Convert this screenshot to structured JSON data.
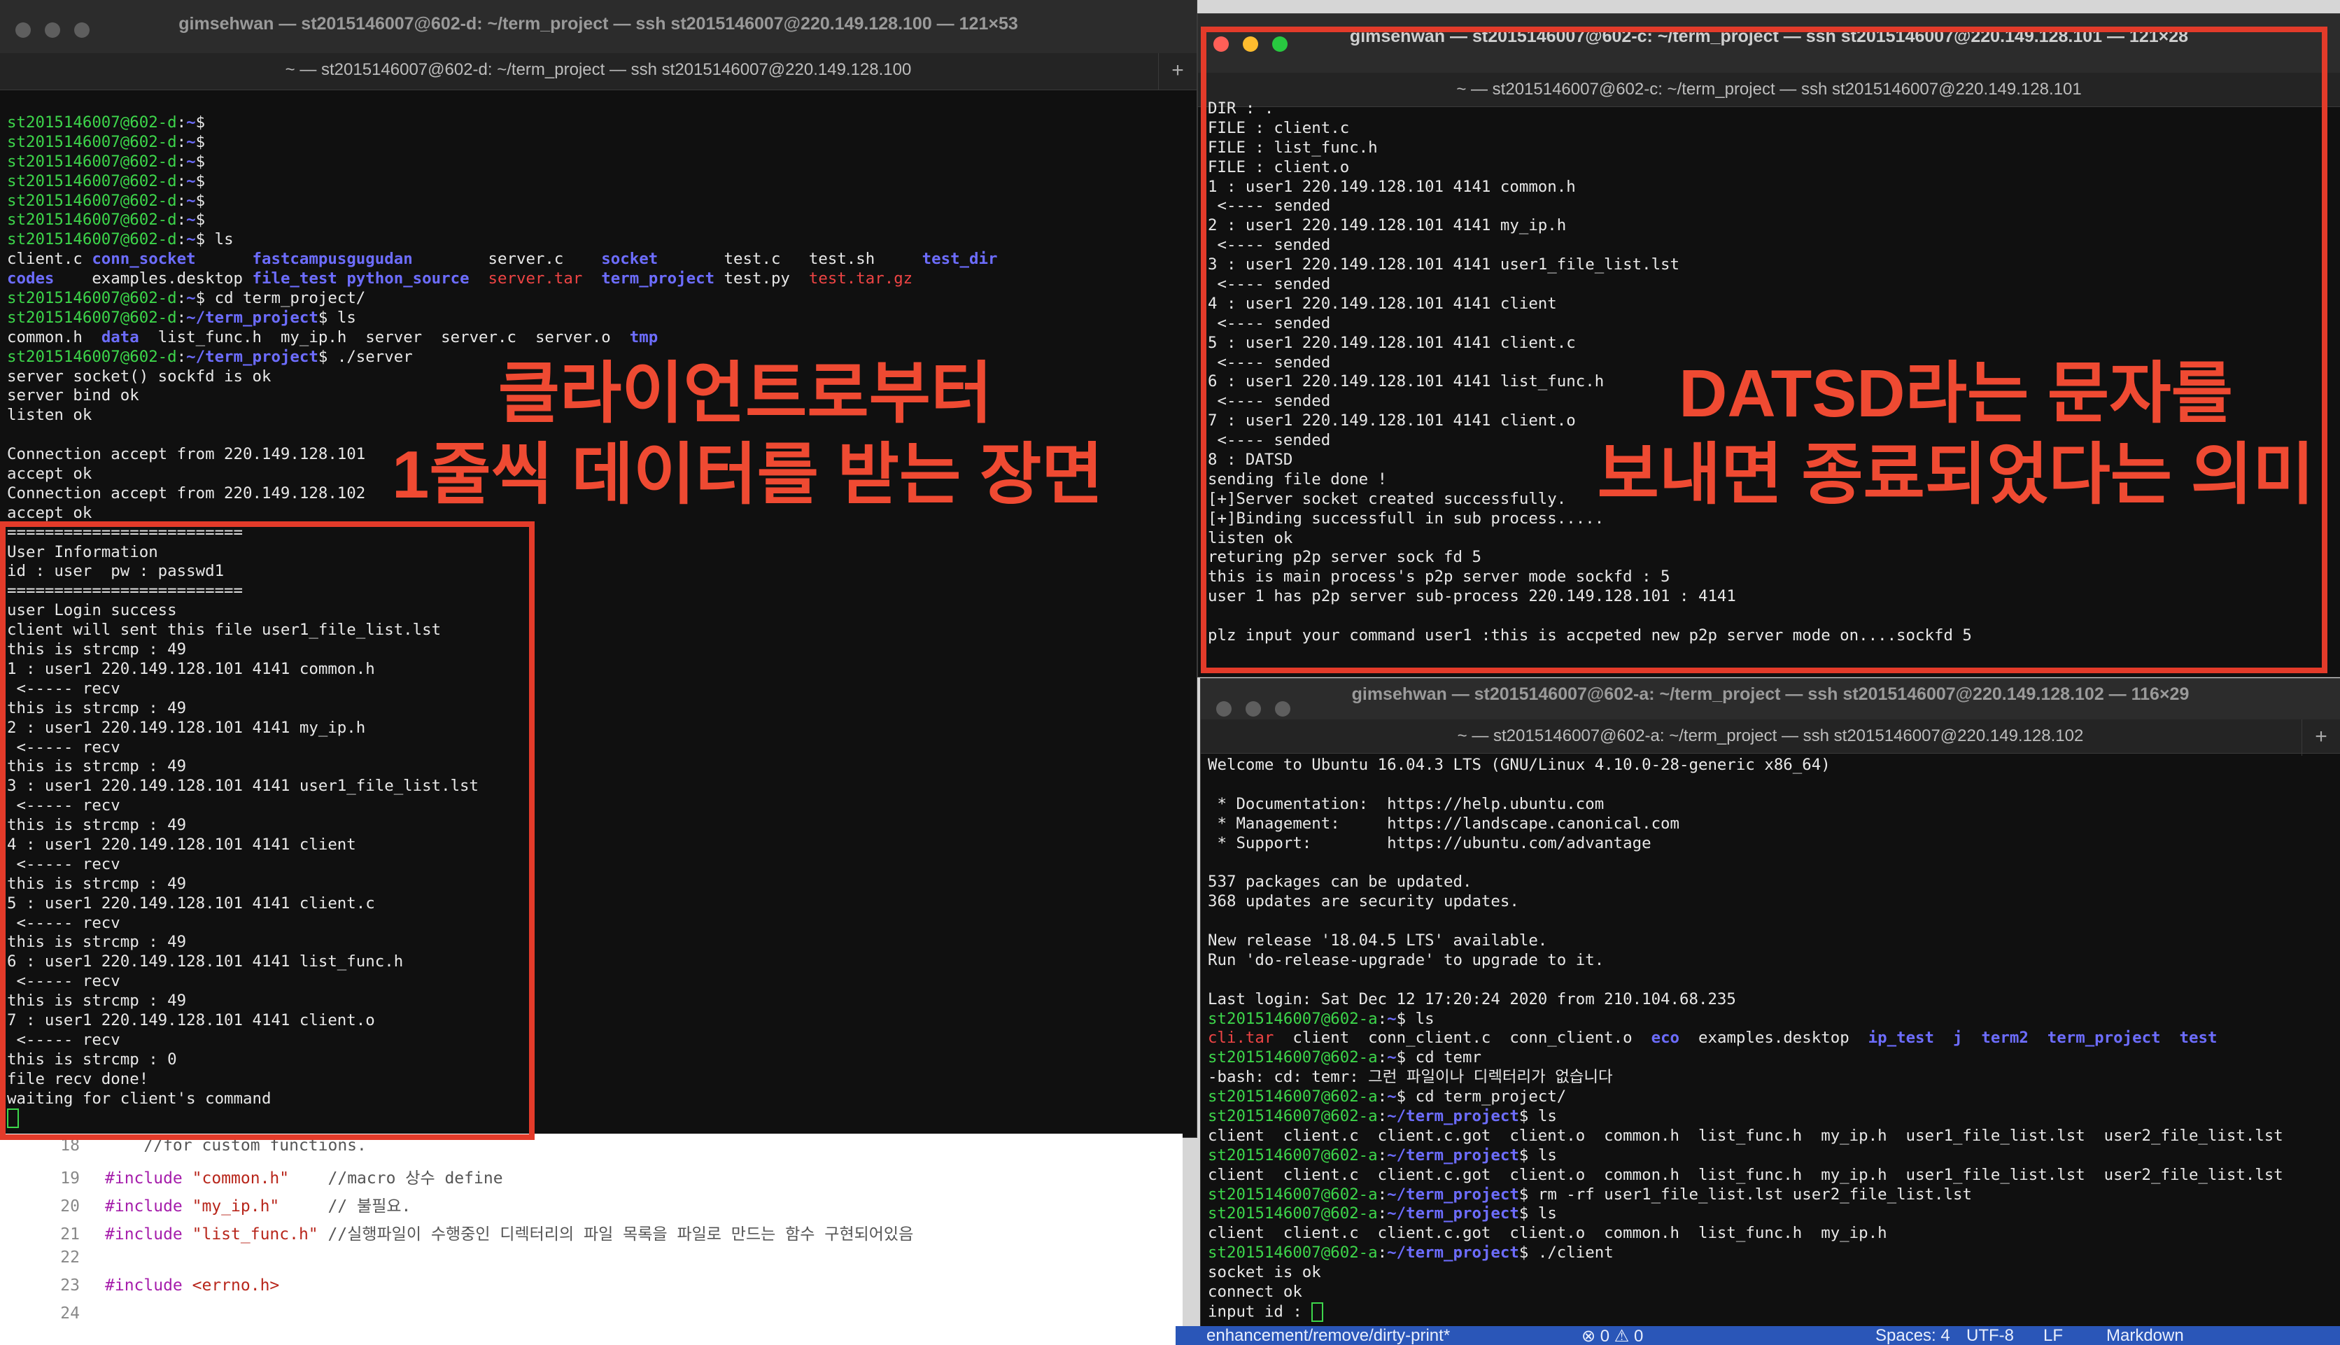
{
  "window_left": {
    "title": "gimsehwan — st2015146007@602-d: ~/term_project — ssh st2015146007@220.149.128.100 — 121×53",
    "tab": "~ — st2015146007@602-d: ~/term_project — ssh st2015146007@220.149.128.100",
    "prompt": "st2015146007@602-d",
    "prompt_sep": ":",
    "home": "~",
    "path": "~/term_project",
    "dollar": "$",
    "cmd_ls": " ls",
    "cmd_cd": " cd term_project/",
    "cmd_server": " ./server",
    "ls1_row1": [
      "client.c",
      "conn_socket",
      "fastcampus",
      "gugudan",
      "server.c",
      "socket",
      "test.c",
      "test.sh",
      "test_dir"
    ],
    "ls1_row2": [
      "codes",
      "examples.desktop",
      "file_test",
      "python_source",
      "server.tar",
      "term_project",
      "test.py",
      "test.tar.gz"
    ],
    "ls2": [
      "common.h",
      "data",
      "list_func.h",
      "my_ip.h",
      "server",
      "server.c",
      "server.o",
      "tmp"
    ],
    "lines_after": [
      "server socket() sockfd is ok",
      "server bind ok",
      "listen ok",
      "",
      "Connection accept from 220.149.128.101",
      "accept ok",
      "Connection accept from 220.149.128.102",
      "accept ok",
      "=========================",
      "User Information",
      "id : user  pw : passwd1",
      "=========================",
      "user Login success",
      "client will sent this file user1_file_list.lst",
      "this is strcmp : 49",
      "1 : user1 220.149.128.101 4141 common.h",
      " <----- recv",
      "this is strcmp : 49",
      "2 : user1 220.149.128.101 4141 my_ip.h",
      " <----- recv",
      "this is strcmp : 49",
      "3 : user1 220.149.128.101 4141 user1_file_list.lst",
      " <----- recv",
      "this is strcmp : 49",
      "4 : user1 220.149.128.101 4141 client",
      " <----- recv",
      "this is strcmp : 49",
      "5 : user1 220.149.128.101 4141 client.c",
      " <----- recv",
      "this is strcmp : 49",
      "6 : user1 220.149.128.101 4141 list_func.h",
      " <----- recv",
      "this is strcmp : 49",
      "7 : user1 220.149.128.101 4141 client.o",
      " <----- recv",
      "this is strcmp : 0",
      "file recv done!",
      "waiting for client's command"
    ]
  },
  "window_right_top": {
    "title": "gimsehwan — st2015146007@602-c: ~/term_project — ssh st2015146007@220.149.128.101 — 121×28",
    "tab": "~ — st2015146007@602-c: ~/term_project — ssh st2015146007@220.149.128.101",
    "lines": [
      "DIR : .",
      "FILE : client.c",
      "FILE : list_func.h",
      "FILE : client.o",
      "1 : user1 220.149.128.101 4141 common.h",
      " <---- sended",
      "2 : user1 220.149.128.101 4141 my_ip.h",
      " <---- sended",
      "3 : user1 220.149.128.101 4141 user1_file_list.lst",
      " <---- sended",
      "4 : user1 220.149.128.101 4141 client",
      " <---- sended",
      "5 : user1 220.149.128.101 4141 client.c",
      " <---- sended",
      "6 : user1 220.149.128.101 4141 list_func.h",
      " <---- sended",
      "7 : user1 220.149.128.101 4141 client.o",
      " <---- sended",
      "8 : DATSD",
      "sending file done !",
      "[+]Server socket created successfully.",
      "[+]Binding successfull in sub process.....",
      "listen ok",
      "returing p2p server sock fd 5",
      "this is main process's p2p server mode sockfd : 5",
      "user 1 has p2p server sub-process 220.149.128.101 : 4141",
      "",
      "plz input your command user1 :this is accpeted new p2p server mode on....sockfd 5"
    ]
  },
  "window_right_bottom": {
    "title": "gimsehwan — st2015146007@602-a: ~/term_project — ssh st2015146007@220.149.128.102 — 116×29",
    "tab": "~ — st2015146007@602-a: ~/term_project — ssh st2015146007@220.149.128.102",
    "prompt": "st2015146007@602-a",
    "lines_top": [
      "Welcome to Ubuntu 16.04.3 LTS (GNU/Linux 4.10.0-28-generic x86_64)",
      "",
      " * Documentation:  https://help.ubuntu.com",
      " * Management:     https://landscape.canonical.com",
      " * Support:        https://ubuntu.com/advantage",
      "",
      "537 packages can be updated.",
      "368 updates are security updates.",
      "",
      "New release '18.04.5 LTS' available.",
      "Run 'do-release-upgrade' to upgrade to it.",
      "",
      "Last login: Sat Dec 12 17:20:24 2020 from 210.104.68.235"
    ],
    "ls_home": {
      "red": [
        "cli.tar"
      ],
      "white1": [
        "client",
        "conn_client.c",
        "conn_client.o"
      ],
      "blue1": [
        "eco"
      ],
      "white2": [
        "examples.desktop"
      ],
      "blue2": [
        "ip_test",
        "j",
        "term2",
        "term_project",
        "test"
      ]
    },
    "cmd_cd_temr": " cd temr",
    "bash_err": "-bash: cd: temr: 그런 파일이나 디렉터리가 없습니다",
    "cmd_cd_tp": " cd term_project/",
    "cmd_ls": " ls",
    "ls_a": "client  client.c  client.c.got  client.o  common.h  list_func.h  my_ip.h  user1_file_list.lst  user2_file_list.lst",
    "cmd_rm": " rm -rf user1_file_list.lst user2_file_list.lst",
    "ls_b": "client  client.c  client.c.got  client.o  common.h  list_func.h  my_ip.h",
    "cmd_client": " ./client",
    "tail": [
      "socket is ok",
      "connect ok",
      "input id : "
    ]
  },
  "annotations": {
    "left_line1": "클라이언트로부터",
    "left_line2": "1줄씩 데이터를 받는 장면",
    "right_line1": "DATSD라는 문자를",
    "right_line2": "보내면 종료되었다는 의미"
  },
  "editor": {
    "lines": [
      {
        "num": "18",
        "text": "    //for custom functions."
      },
      {
        "num": "19",
        "inc": "#include",
        "str": "\"common.h\"",
        "cm": "    //macro 상수 define"
      },
      {
        "num": "20",
        "inc": "#include",
        "str": "\"my_ip.h\"",
        "cm": "     // 불필요."
      },
      {
        "num": "21",
        "inc": "#include",
        "str": "\"list_func.h\"",
        "cm": " //실행파일이 수행중인 디렉터리의 파일 목록을 파일로 만드는 함수 구현되어있음"
      },
      {
        "num": "22",
        "text": ""
      },
      {
        "num": "23",
        "inc": "#include",
        "str": "<errno.h>",
        "cm": ""
      },
      {
        "num": "24",
        "text": ""
      }
    ]
  },
  "statusbar": {
    "branch": "enhancement/remove/dirty-print*",
    "problems": "⊗ 0 ⚠ 0",
    "spaces": "Spaces: 4",
    "encoding": "UTF-8",
    "eol": "LF",
    "language": "Markdown"
  },
  "colors": {
    "annotation": "#e33b2a",
    "prompt": "#3dd64b",
    "dir": "#6d6dff"
  }
}
